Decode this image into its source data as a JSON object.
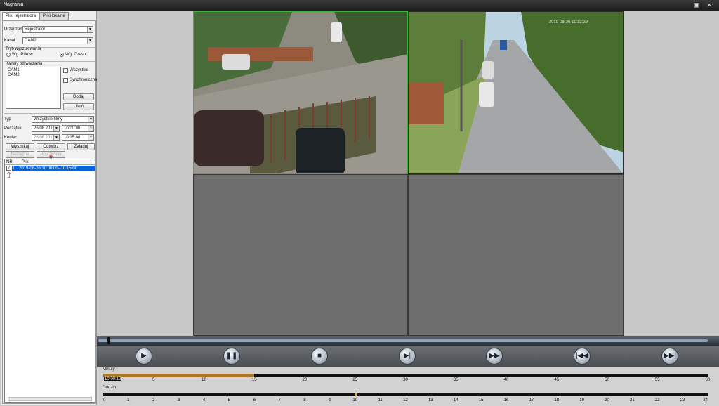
{
  "window": {
    "title": "Nagrania",
    "restore_icon": "restore-icon",
    "close_icon": "close-icon"
  },
  "tabs": [
    "Pliki rejestratora",
    "Pliki lokalne"
  ],
  "form": {
    "device_label": "Urządzenie",
    "device_value": "Rejestrator",
    "channel_label": "Kanał",
    "channel_value": "CAM2",
    "search_mode_label": "Tryb wyszukiwania",
    "by_files": "Wg. Plików",
    "by_time": "Wg. Czasu",
    "search_mode_selected": "by_time",
    "playback_channels_label": "Kanały odtwarzania",
    "channels": [
      "CAM1",
      "CAM2"
    ],
    "all_label": "Wszystkie",
    "sync_label": "Synchroniczne",
    "add_button": "Dodaj",
    "remove_button": "Usuń",
    "type_label": "Typ",
    "type_value": "Wszystkie filmy",
    "start_label": "Początek",
    "start_date": "26.08.2019",
    "start_time": "10:00:00",
    "end_label": "Koniec",
    "end_date": "26.08.2019",
    "end_time": "10:15:00",
    "search_button": "Wyszukaj",
    "open_button": "Odtwórz",
    "download_button": "Załaduj",
    "next_button": "Następne",
    "prev_button": "Poprzednie"
  },
  "file_table": {
    "headers": [
      "NR",
      "Plik"
    ],
    "rows": [
      {
        "nr": "1",
        "file": "2019-08-26 10:00:00--10:15:00",
        "checked": true
      }
    ]
  },
  "cameras": [
    {
      "name": "CAM1",
      "selected": true,
      "timestamp": ""
    },
    {
      "name": "CAM2",
      "selected": false,
      "timestamp": "2019-08-26 11:13:29"
    }
  ],
  "controls": {
    "play": "play-icon",
    "pause": "pause-icon",
    "stop": "stop-icon",
    "step": "step-forward-icon",
    "fast": "fast-forward-icon",
    "prev": "skip-back-icon",
    "next": "skip-forward-icon"
  },
  "timeline": {
    "minutes_label": "Minuty",
    "hours_label": "Godzin",
    "current_time": "10:00:12",
    "minute_ticks": [
      "5",
      "10",
      "15",
      "20",
      "25",
      "30",
      "35",
      "40",
      "45",
      "50",
      "55",
      "60"
    ],
    "hour_ticks": [
      "0",
      "1",
      "2",
      "3",
      "4",
      "5",
      "6",
      "7",
      "8",
      "9",
      "10",
      "11",
      "12",
      "13",
      "14",
      "15",
      "16",
      "17",
      "18",
      "19",
      "20",
      "21",
      "22",
      "23",
      "24"
    ],
    "recorded_minutes": [
      0,
      15
    ],
    "current_hour": 10
  },
  "colors": {
    "selected_border": "#3cb43c",
    "record_mark": "#e8a23b",
    "annotation": "#dd0000",
    "row_highlight": "#0a64d8"
  }
}
